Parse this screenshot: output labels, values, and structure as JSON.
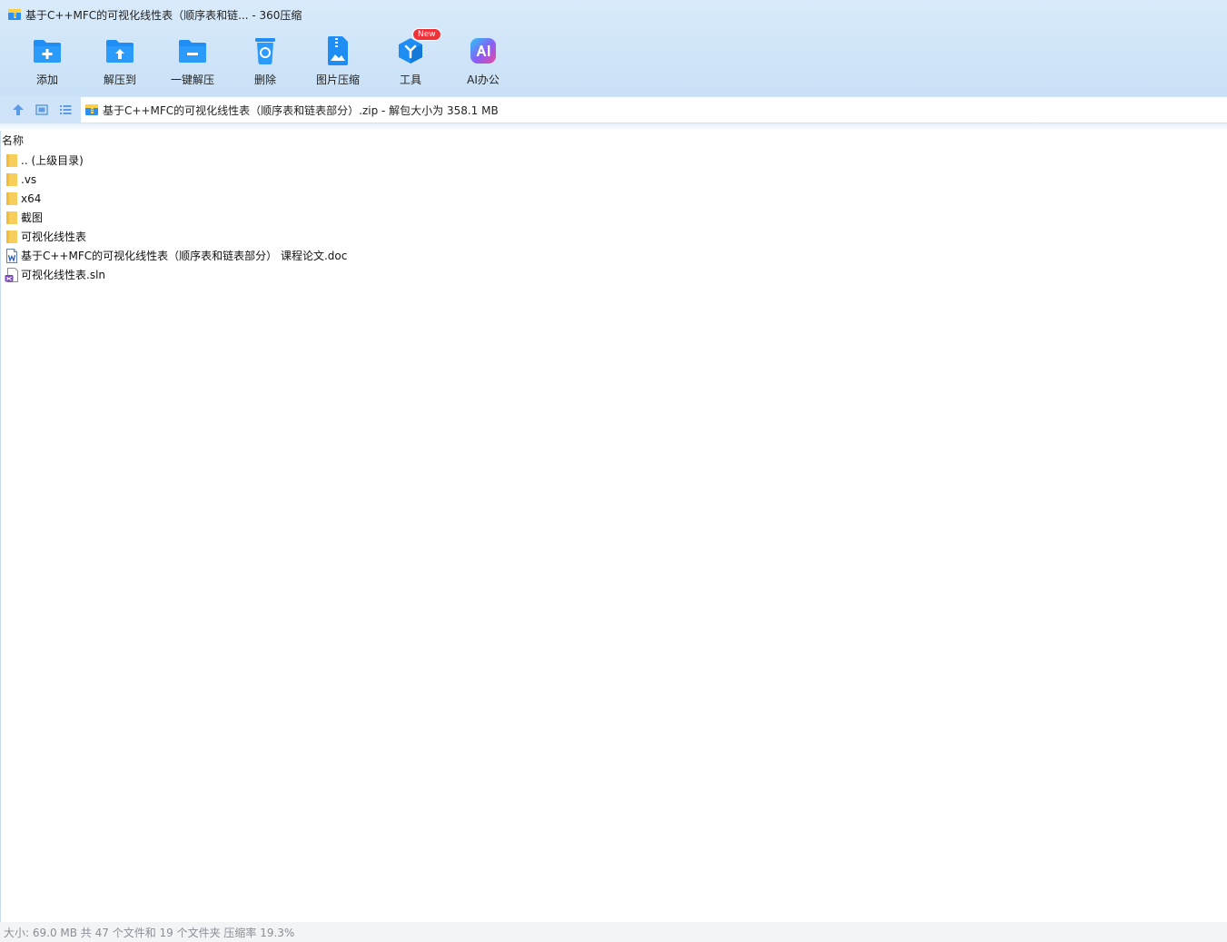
{
  "window": {
    "title": "基于C++MFC的可视化线性表（顺序表和链... - 360压缩"
  },
  "toolbar": {
    "items": [
      {
        "label": "添加",
        "icon": "add-folder-icon"
      },
      {
        "label": "解压到",
        "icon": "extract-to-icon"
      },
      {
        "label": "一键解压",
        "icon": "one-click-extract-icon"
      },
      {
        "label": "删除",
        "icon": "delete-icon"
      },
      {
        "label": "图片压缩",
        "icon": "image-compress-icon"
      },
      {
        "label": "工具",
        "icon": "tools-icon",
        "badge": "New"
      },
      {
        "label": "AI办公",
        "icon": "ai-office-icon"
      }
    ]
  },
  "nav": {
    "buttons": [
      {
        "icon": "up-arrow-icon"
      },
      {
        "icon": "thumbnail-view-icon"
      },
      {
        "icon": "list-view-icon"
      }
    ]
  },
  "address": {
    "text": "基于C++MFC的可视化线性表（顺序表和链表部分）.zip - 解包大小为 358.1 MB"
  },
  "list": {
    "column_header": "名称",
    "rows": [
      {
        "name": ".. (上级目录)",
        "type": "folder"
      },
      {
        "name": ".vs",
        "type": "folder"
      },
      {
        "name": "x64",
        "type": "folder"
      },
      {
        "name": "截图",
        "type": "folder"
      },
      {
        "name": "可视化线性表",
        "type": "folder"
      },
      {
        "name": "基于C++MFC的可视化线性表（顺序表和链表部分） 课程论文.doc",
        "type": "doc"
      },
      {
        "name": "可视化线性表.sln",
        "type": "sln"
      }
    ]
  },
  "status": {
    "text": "大小: 69.0 MB 共 47 个文件和 19 个文件夹 压缩率 19.3%"
  },
  "colors": {
    "accent": "#1e8ef5",
    "header_bg": "#cfe4f8",
    "folder": "#f7cd5c",
    "badge": "#f0313a",
    "status_text": "#8a8f96"
  }
}
